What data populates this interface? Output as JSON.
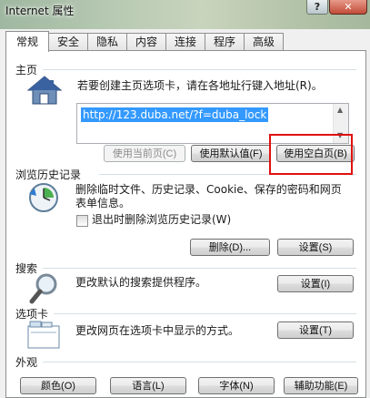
{
  "window": {
    "title": "Internet 属性",
    "help_label": "?",
    "close_label": "✕"
  },
  "tabs": [
    {
      "label": "常规",
      "active": true
    },
    {
      "label": "安全",
      "active": false
    },
    {
      "label": "隐私",
      "active": false
    },
    {
      "label": "内容",
      "active": false
    },
    {
      "label": "连接",
      "active": false
    },
    {
      "label": "程序",
      "active": false
    },
    {
      "label": "高级",
      "active": false
    }
  ],
  "home": {
    "title": "主页",
    "description": "若要创建主页选项卡，请在各地址行键入地址(R)。",
    "url": "http://123.duba.net/?f=duba_lock",
    "buttons": {
      "use_current": "使用当前页(C)",
      "use_default": "使用默认值(F)",
      "use_blank": "使用空白页(B)"
    },
    "highlight_color": "#e01010"
  },
  "history": {
    "title": "浏览历史记录",
    "description_line1": "删除临时文件、历史记录、Cookie、保存的密码和网页",
    "description_line2": "表单信息。",
    "checkbox_label": "退出时删除浏览历史记录(W)",
    "checkbox_checked": false,
    "delete_button": "删除(D)...",
    "settings_button": "设置(S)"
  },
  "search": {
    "title": "搜索",
    "description": "更改默认的搜索提供程序。",
    "settings_button": "设置(I)"
  },
  "tabbing": {
    "title": "选项卡",
    "description": "更改网页在选项卡中显示的方式。",
    "settings_button": "设置(T)"
  },
  "appearance": {
    "title": "外观",
    "buttons": {
      "colors": "颜色(O)",
      "languages": "语言(L)",
      "fonts": "字体(N)",
      "accessibility": "辅助功能(E)"
    }
  },
  "icons": {
    "home": "house-icon",
    "history": "history-clock-icon",
    "search": "magnifier-icon",
    "tabs": "tabbed-window-icon"
  }
}
